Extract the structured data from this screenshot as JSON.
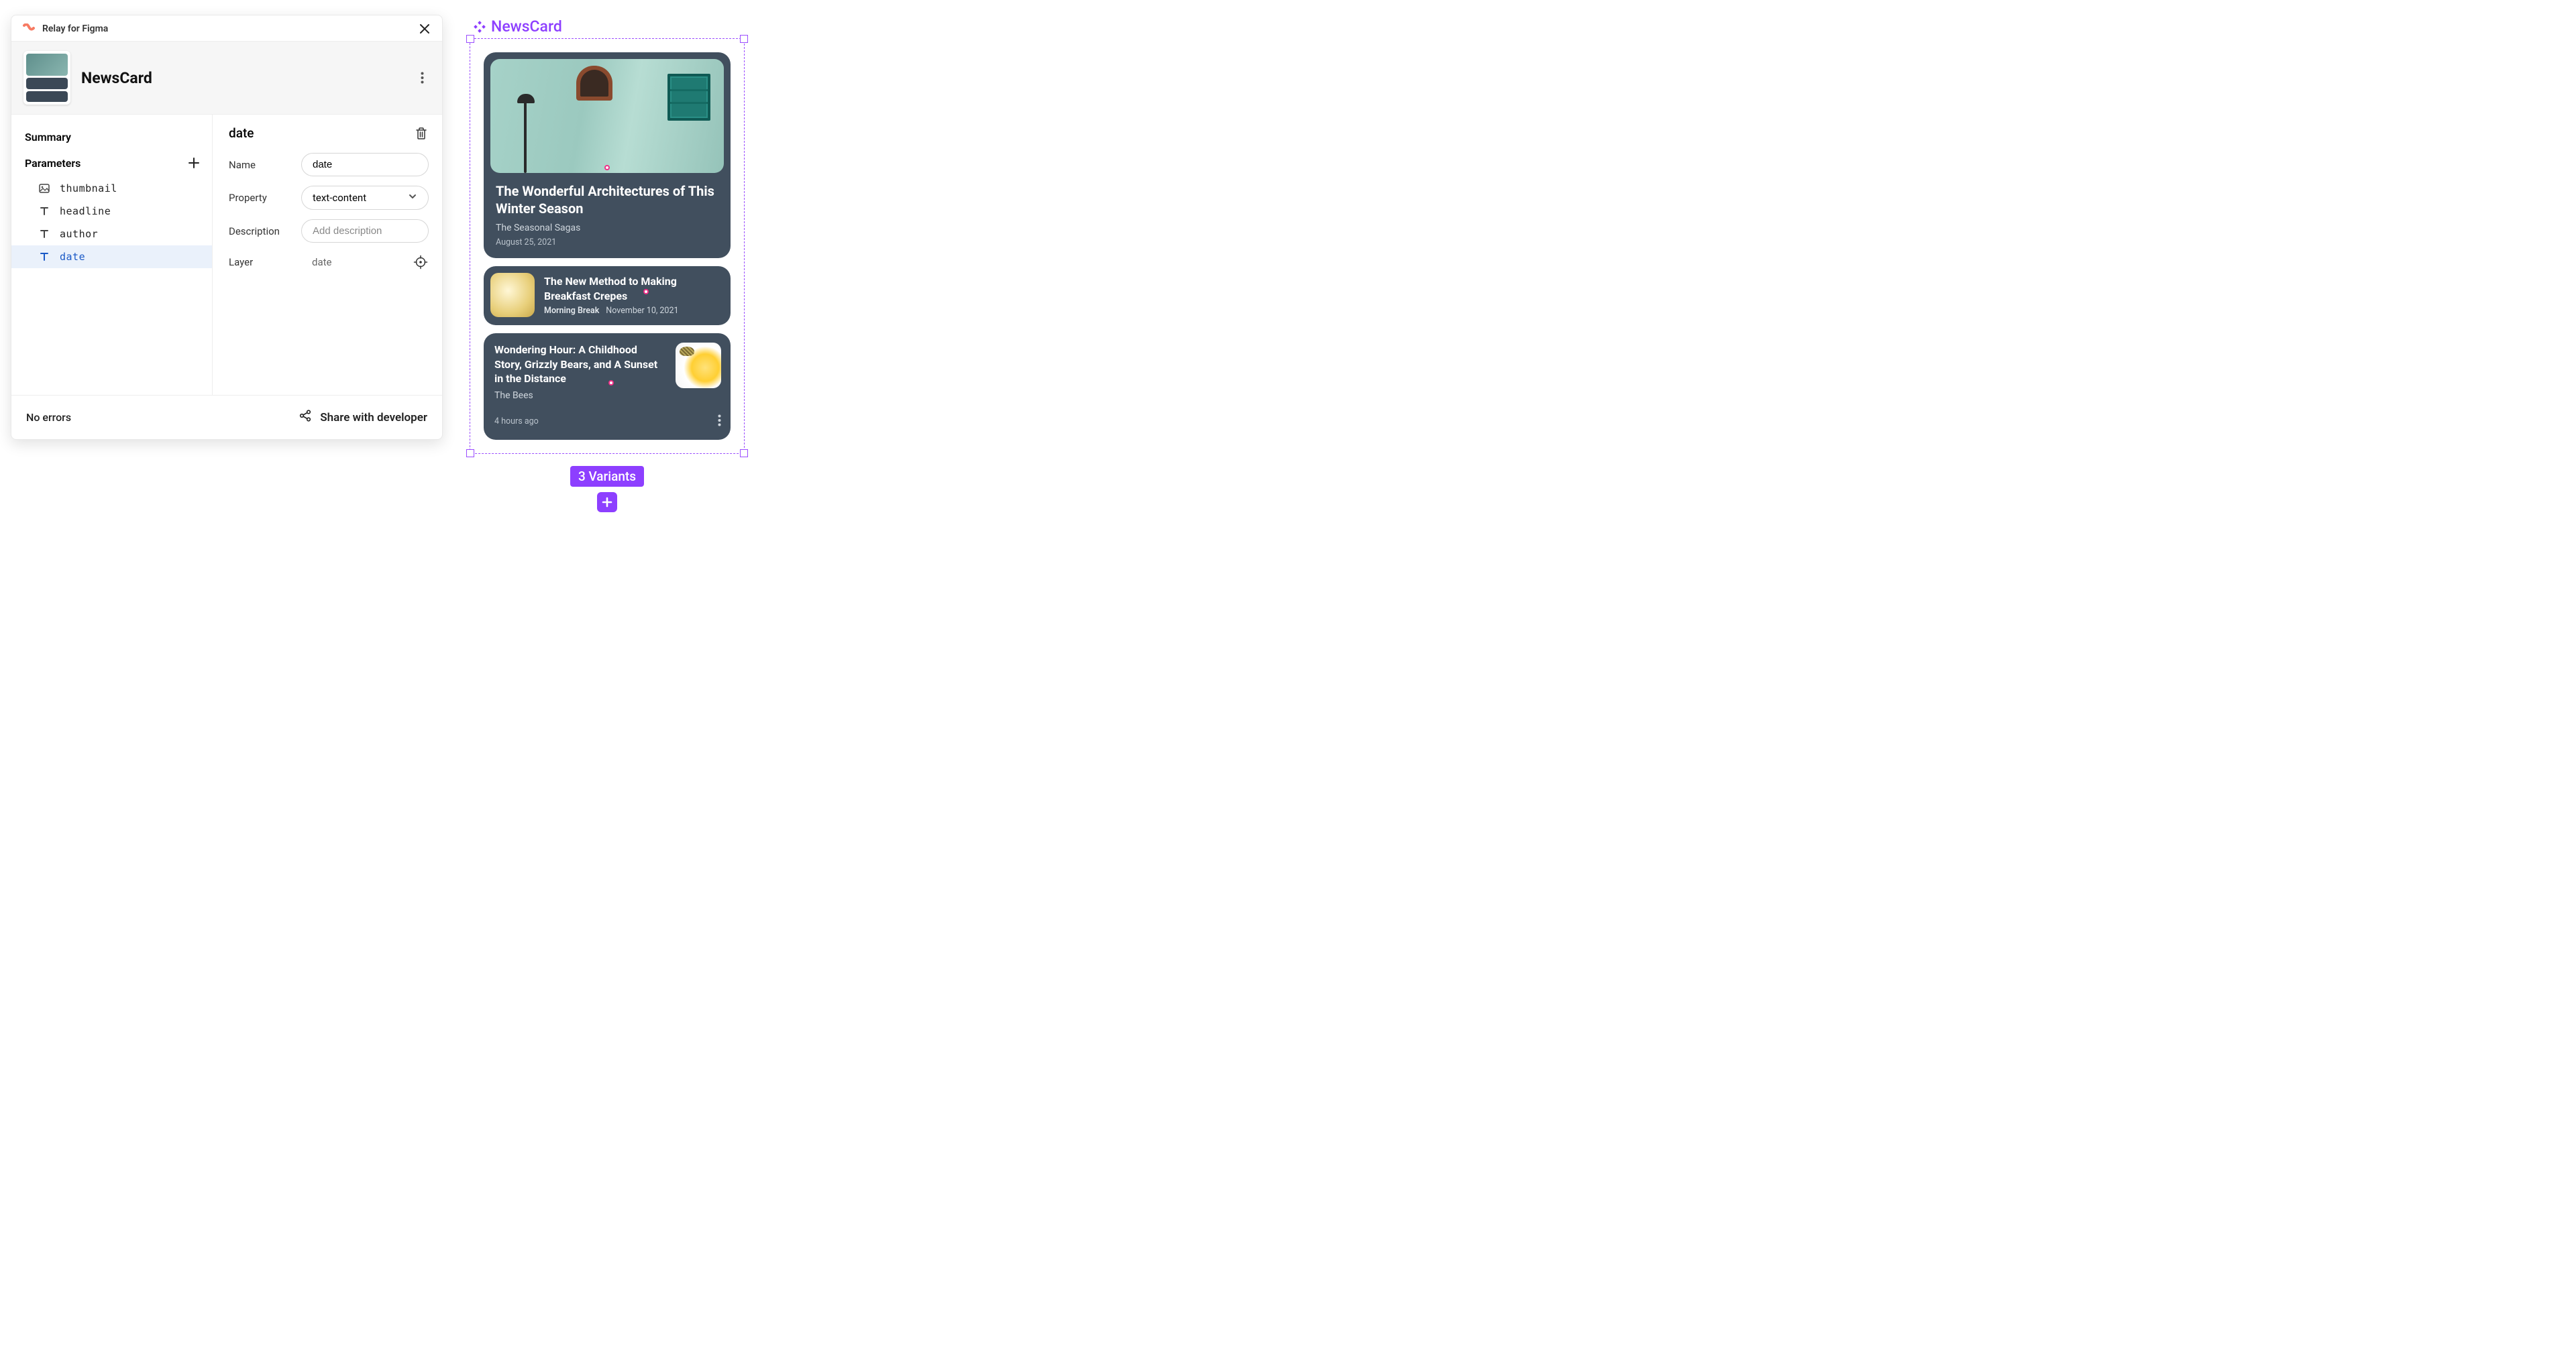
{
  "plugin_title": "Relay for Figma",
  "component_name": "NewsCard",
  "sidebar": {
    "summary_label": "Summary",
    "parameters_label": "Parameters",
    "params": [
      {
        "icon": "image",
        "name": "thumbnail"
      },
      {
        "icon": "text",
        "name": "headline"
      },
      {
        "icon": "text",
        "name": "author"
      },
      {
        "icon": "text",
        "name": "date"
      }
    ]
  },
  "detail": {
    "title": "date",
    "labels": {
      "name": "Name",
      "property": "Property",
      "description": "Description",
      "layer": "Layer"
    },
    "name_value": "date",
    "property_value": "text-content",
    "description_placeholder": "Add description",
    "layer_value": "date"
  },
  "footer": {
    "status": "No errors",
    "share_label": "Share with developer"
  },
  "canvas": {
    "frame_label": "NewsCard",
    "variants_badge": "3 Variants",
    "cards": [
      {
        "headline": "The Wonderful Architectures of This Winter Season",
        "author": "The Seasonal Sagas",
        "date": "August 25, 2021"
      },
      {
        "headline": "The New Method to Making Breakfast Crepes",
        "author": "Morning Break",
        "date": "November 10, 2021"
      },
      {
        "headline": "Wondering Hour: A Childhood Story, Grizzly Bears, and A Sunset in the Distance",
        "author": "The Bees",
        "date": "4 hours ago"
      }
    ]
  }
}
